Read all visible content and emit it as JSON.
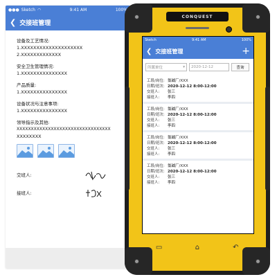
{
  "back_screen": {
    "status": {
      "carrier": "Sketch",
      "time": "9:41 AM",
      "battery": "100%"
    },
    "title": "交接班管理",
    "sections": [
      {
        "title": "设备及工艺情况:",
        "lines": [
          "1.XXXXXXXXXXXXXXXXXXXX",
          "2.XXXXXXXXXXXXX"
        ]
      },
      {
        "title": "安全卫生管理情况:",
        "lines": [
          "1.XXXXXXXXXXXXXXX"
        ]
      },
      {
        "title": "产品质量:",
        "lines": [
          "1.XXXXXXXXXXXXXXX"
        ]
      },
      {
        "title": "设备状况与注意事项:",
        "lines": [
          "1.XXXXXXXXXXXXXXX"
        ]
      },
      {
        "title": "领导指示及其他:",
        "lines": [
          "XXXXXXXXXXXXXXXXXXXXXXXXXXXXXXXXX",
          "XXXXXXXX"
        ]
      }
    ],
    "handover_label": "交班人:",
    "receiver_label": "接班人:"
  },
  "phone": {
    "brand": "CONQUEST",
    "screen": {
      "status": {
        "carrier": "Sketch",
        "time": "9:41 AM",
        "battery": "100%"
      },
      "title": "交接班管理",
      "add_icon": "plus-icon",
      "filter": {
        "dept_placeholder": "所属单位",
        "date": "2020-12-12",
        "query_label": "查询"
      },
      "record_labels": {
        "post": "工段/岗位:",
        "date": "日期/班次:",
        "handover": "交班人:",
        "receiver": "接班人:"
      },
      "records": [
        {
          "post": "氯碱厂/XXX",
          "date": "2020-12-12  8:00-12:00",
          "handover": "张三",
          "receiver": "李四"
        },
        {
          "post": "氯碱厂/XXX",
          "date": "2020-12-12  8:00-12:00",
          "handover": "张三",
          "receiver": "李四"
        },
        {
          "post": "氯碱厂/XXX",
          "date": "2020-12-12  8:00-12:00",
          "handover": "张三",
          "receiver": "李四"
        },
        {
          "post": "氯碱厂/XXX",
          "date": "2020-12-12  8:00-12:00",
          "handover": "张三",
          "receiver": "李四"
        }
      ]
    }
  },
  "colors": {
    "primary": "#4a7fd6",
    "phone_yellow": "#f2c418",
    "phone_black": "#1e1e1e"
  }
}
